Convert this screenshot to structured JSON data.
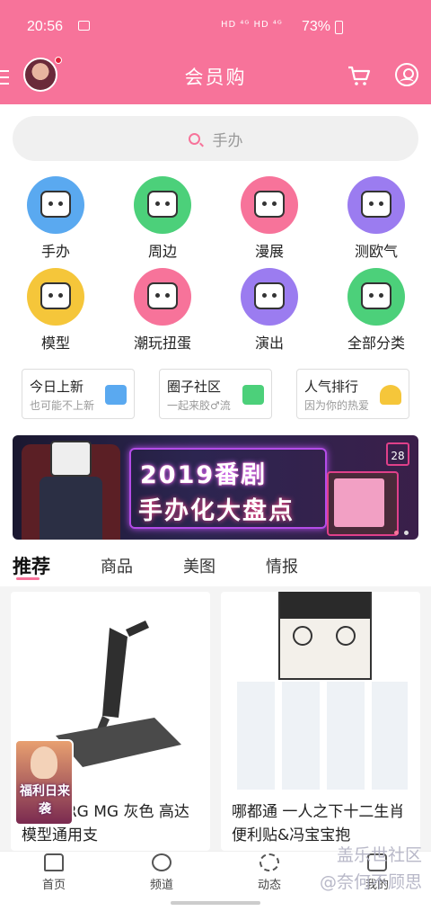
{
  "status_bar": {
    "time": "20:56",
    "network": "HD ⁴ᴳ HD ⁴ᴳ",
    "battery": "73%"
  },
  "app_bar": {
    "title": "会员购"
  },
  "search": {
    "placeholder": "手办"
  },
  "categories": [
    {
      "label": "手办",
      "color": "#5aa9f0"
    },
    {
      "label": "周边",
      "color": "#4cd07a"
    },
    {
      "label": "漫展",
      "color": "#f7739a"
    },
    {
      "label": "测欧气",
      "color": "#9b7cf0"
    },
    {
      "label": "模型",
      "color": "#f5c63a"
    },
    {
      "label": "潮玩扭蛋",
      "color": "#f7739a"
    },
    {
      "label": "演出",
      "color": "#9b7cf0"
    },
    {
      "label": "全部分类",
      "color": "#4cd07a"
    }
  ],
  "quick_links": [
    {
      "title": "今日上新",
      "sub": "也可能不上新"
    },
    {
      "title": "圈子社区",
      "sub": "一起来胶♂流"
    },
    {
      "title": "人气排行",
      "sub": "因为你的热爱"
    }
  ],
  "banner": {
    "line1": "2019番剧",
    "line2": "手办化大盘点",
    "badge": "28"
  },
  "feed_tabs": [
    "推荐",
    "商品",
    "美图",
    "情报"
  ],
  "products": [
    {
      "title": "D HG RG MG 灰色 高达模型通用支"
    },
    {
      "title": "哪都通 一人之下十二生肖便利贴&冯宝宝抱"
    }
  ],
  "floating_badge": {
    "text": "福利日来袭"
  },
  "bottom_nav": [
    "首页",
    "频道",
    "动态",
    "我的"
  ],
  "watermark": {
    "line1": "盖乐世社区",
    "line2": "@奈何不顾思"
  }
}
